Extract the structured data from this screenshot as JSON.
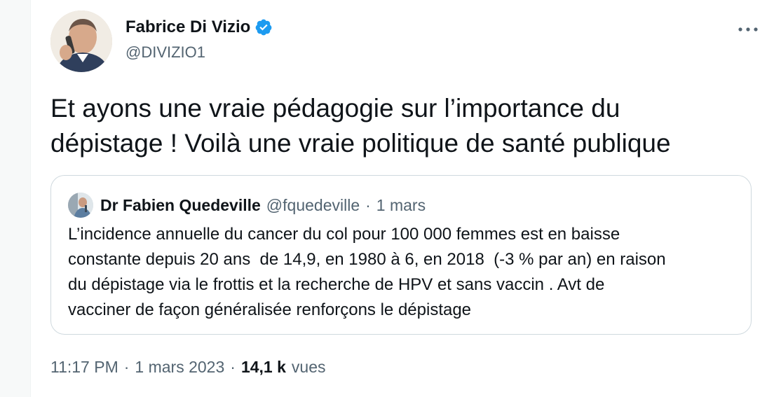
{
  "author": {
    "name": "Fabrice Di Vizio",
    "handle": "@DIVIZIO1",
    "verified_color": "#1d9bf0"
  },
  "tweet": {
    "text": "Et ayons une vraie pédagogie sur l’importance du\ndépistage ! Voilà une vraie politique de santé publique"
  },
  "quoted_tweet": {
    "name": "Dr Fabien Quedeville",
    "handle": "@fquedeville",
    "separator": "·",
    "date": "1 mars",
    "text": "L’incidence annuelle du cancer du col pour 100 000 femmes est en baisse\nconstante depuis 20 ans  de 14,9, en 1980 à 6, en 2018  (-3 % par an) en raison\ndu dépistage via le frottis et la recherche de HPV et sans vaccin . Avt de\nvacciner de façon généralisée renforçons le dépistage"
  },
  "meta": {
    "time": "11:17 PM",
    "sep1": "·",
    "date": "1 mars 2023",
    "sep2": "·",
    "views_count": "14,1 k",
    "views_label": "vues"
  },
  "icons": {
    "verified": "verified-badge-icon",
    "more": "more-options-icon"
  }
}
